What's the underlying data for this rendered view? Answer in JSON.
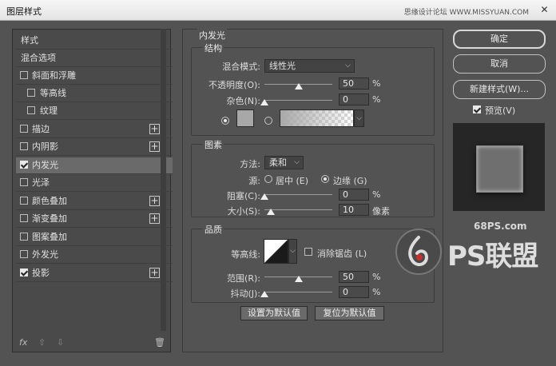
{
  "window": {
    "title": "图层样式",
    "watermark": "思缘设计论坛 WWW.MISSYUAN.COM",
    "close_symbol": "✕"
  },
  "left_panel": {
    "items": [
      {
        "label": "样式",
        "checkbox": null,
        "plus": false,
        "selected": false
      },
      {
        "label": "混合选项",
        "checkbox": null,
        "plus": false,
        "selected": false
      },
      {
        "label": "斜面和浮雕",
        "checkbox": false,
        "plus": false,
        "selected": false
      },
      {
        "label": "等高线",
        "checkbox": false,
        "plus": false,
        "selected": false,
        "indent": true
      },
      {
        "label": "纹理",
        "checkbox": false,
        "plus": false,
        "selected": false,
        "indent": true
      },
      {
        "label": "描边",
        "checkbox": false,
        "plus": true,
        "selected": false
      },
      {
        "label": "内阴影",
        "checkbox": false,
        "plus": true,
        "selected": false
      },
      {
        "label": "内发光",
        "checkbox": true,
        "plus": false,
        "selected": true
      },
      {
        "label": "光泽",
        "checkbox": false,
        "plus": false,
        "selected": false
      },
      {
        "label": "颜色叠加",
        "checkbox": false,
        "plus": true,
        "selected": false
      },
      {
        "label": "渐变叠加",
        "checkbox": false,
        "plus": true,
        "selected": false
      },
      {
        "label": "图案叠加",
        "checkbox": false,
        "plus": false,
        "selected": false
      },
      {
        "label": "外发光",
        "checkbox": false,
        "plus": false,
        "selected": false
      },
      {
        "label": "投影",
        "checkbox": true,
        "plus": true,
        "selected": false
      }
    ],
    "footer": {
      "fx": "fx",
      "up": "⇧",
      "down": "⇩",
      "trash": "🗑"
    },
    "plus_symbol": "+"
  },
  "inner_glow": {
    "title": "内发光",
    "structure": {
      "title": "结构",
      "blend_mode_label": "混合模式:",
      "blend_mode": "线性光",
      "opacity_label": "不透明度(O):",
      "opacity": "50",
      "opacity_fraction": 0.5,
      "noise_label": "杂色(N):",
      "noise": "0",
      "unit": "%"
    },
    "elements": {
      "title": "图素",
      "method_label": "方法:",
      "method": "柔和",
      "source_label": "源:",
      "source_center": "居中 (E)",
      "source_edge": "边缘 (G)",
      "source_selected": "edge",
      "choke_label": "阻塞(C):",
      "choke": "0",
      "size_label": "大小(S):",
      "size": "10",
      "size_unit": "像素"
    },
    "quality": {
      "title": "品质",
      "contour_label": "等高线:",
      "antialias_label": "消除锯齿 (L)",
      "range_label": "范围(R):",
      "range": "50",
      "range_fraction": 0.5,
      "jitter_label": "抖动(J):",
      "jitter": "0"
    },
    "buttons": {
      "set_default": "设置为默认值",
      "reset_default": "复位为默认值"
    }
  },
  "right_panel": {
    "ok": "确定",
    "cancel": "取消",
    "new_style": "新建样式(W)...",
    "preview_label": "预览(V)",
    "preview_checked": true
  },
  "branding": {
    "site": "68PS.com",
    "name": "PS联盟"
  },
  "colors": {
    "background": "#535353",
    "panel": "#4a4a4a",
    "selected_row": "#6a6a6a",
    "glow_color": "#a8a8a8",
    "preview_bg": "#262626"
  }
}
